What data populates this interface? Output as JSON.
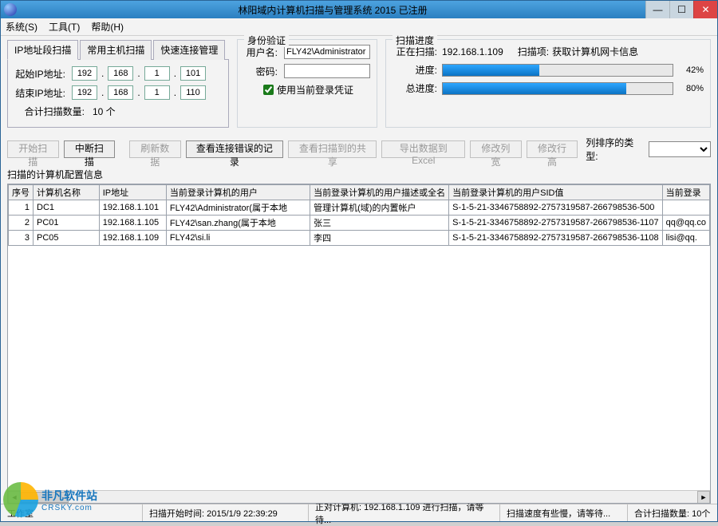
{
  "window": {
    "title": "林阳域内计算机扫描与管理系统 2015 已注册"
  },
  "menu": {
    "system": "系统(S)",
    "tools": "工具(T)",
    "help": "帮助(H)"
  },
  "tabs": {
    "ipscan": "IP地址段扫描",
    "hostscan": "常用主机扫描",
    "connmgr": "快速连接管理"
  },
  "ipscan": {
    "start_label": "起始IP地址:",
    "end_label": "结束IP地址:",
    "start": [
      "192",
      "168",
      "1",
      "101"
    ],
    "end": [
      "192",
      "168",
      "1",
      "110"
    ],
    "count_label": "合计扫描数量:",
    "count": "10 个"
  },
  "auth": {
    "legend": "身份验证",
    "user_label": "用户名:",
    "user_value": "FLY42\\Administrator",
    "pwd_label": "密码:",
    "pwd_value": "",
    "use_current": "使用当前登录凭证"
  },
  "progress": {
    "legend": "扫描进度",
    "scanning_label": "正在扫描:",
    "scanning_ip": "192.168.1.109",
    "scanitem_label": "扫描项:",
    "scanitem_value": "获取计算机网卡信息",
    "progress_label": "进度:",
    "progress_pct": "42%",
    "progress_val": 42,
    "total_label": "总进度:",
    "total_pct": "80%",
    "total_val": 80
  },
  "toolbar": {
    "start": "开始扫描",
    "stop": "中断扫描",
    "refresh": "刷新数据",
    "viewerr": "查看连接错误的记录",
    "viewshare": "查看扫描到的共享",
    "export": "导出数据到Excel",
    "colwidth": "修改列宽",
    "rowheight": "修改行高",
    "sortlabel": "列排序的类型:"
  },
  "table": {
    "label": "扫描的计算机配置信息",
    "headers": [
      "序号",
      "计算机名称",
      "IP地址",
      "当前登录计算机的用户",
      "当前登录计算机的用户描述或全名",
      "当前登录计算机的用户SID值",
      "当前登录"
    ],
    "rows": [
      {
        "n": "1",
        "name": "DC1",
        "ip": "192.168.1.101",
        "user": "FLY42\\Administrator(属于本地",
        "desc": "管理计算机(域)的内置帐户",
        "sid": "S-1-5-21-3346758892-2757319587-266798536-500",
        "extra": ""
      },
      {
        "n": "2",
        "name": "PC01",
        "ip": "192.168.1.105",
        "user": "FLY42\\san.zhang(属于本地",
        "desc": "张三",
        "sid": "S-1-5-21-3346758892-2757319587-266798536-1107",
        "extra": "qq@qq.co"
      },
      {
        "n": "3",
        "name": "PC05",
        "ip": "192.168.1.109",
        "user": "FLY42\\si.li",
        "desc": "李四",
        "sid": "S-1-5-21-3346758892-2757319587-266798536-1108",
        "extra": "lisi@qq."
      }
    ]
  },
  "status": {
    "copyright": "工作室",
    "start_time": "扫描开始时间: 2015/1/9 22:39:29",
    "current": "正对计算机: 192.168.1.109 进行扫描，请等待...",
    "speed": "扫描速度有些慢，请等待...",
    "count": "合计扫描数量: 10个"
  },
  "watermark": {
    "t1": "非凡软件站",
    "t2": "CRSKY.com"
  }
}
